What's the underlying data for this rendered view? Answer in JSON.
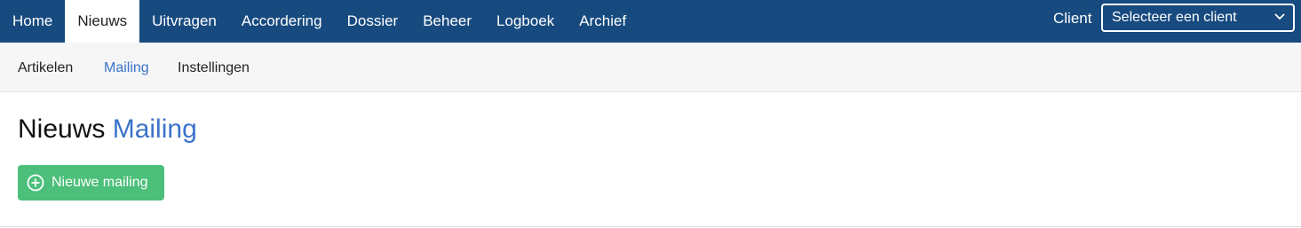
{
  "topnav": {
    "tabs": [
      {
        "label": "Home",
        "active": false
      },
      {
        "label": "Nieuws",
        "active": true
      },
      {
        "label": "Uitvragen",
        "active": false
      },
      {
        "label": "Accordering",
        "active": false
      },
      {
        "label": "Dossier",
        "active": false
      },
      {
        "label": "Beheer",
        "active": false
      },
      {
        "label": "Logboek",
        "active": false
      },
      {
        "label": "Archief",
        "active": false
      }
    ],
    "client_label": "Client",
    "client_select_value": "Selecteer een client"
  },
  "subnav": {
    "items": [
      {
        "label": "Artikelen",
        "active": false
      },
      {
        "label": "Mailing",
        "active": true
      },
      {
        "label": "Instellingen",
        "active": false
      }
    ]
  },
  "page": {
    "title_main": "Nieuws",
    "title_accent": "Mailing",
    "new_button_label": "Nieuwe mailing"
  },
  "colors": {
    "nav_bg": "#174a7e",
    "accent": "#3a73c9",
    "button_green": "#4cc07a"
  },
  "icons": {
    "select_chevron": "chevron-down-icon",
    "new_button": "plus-circle-icon"
  }
}
